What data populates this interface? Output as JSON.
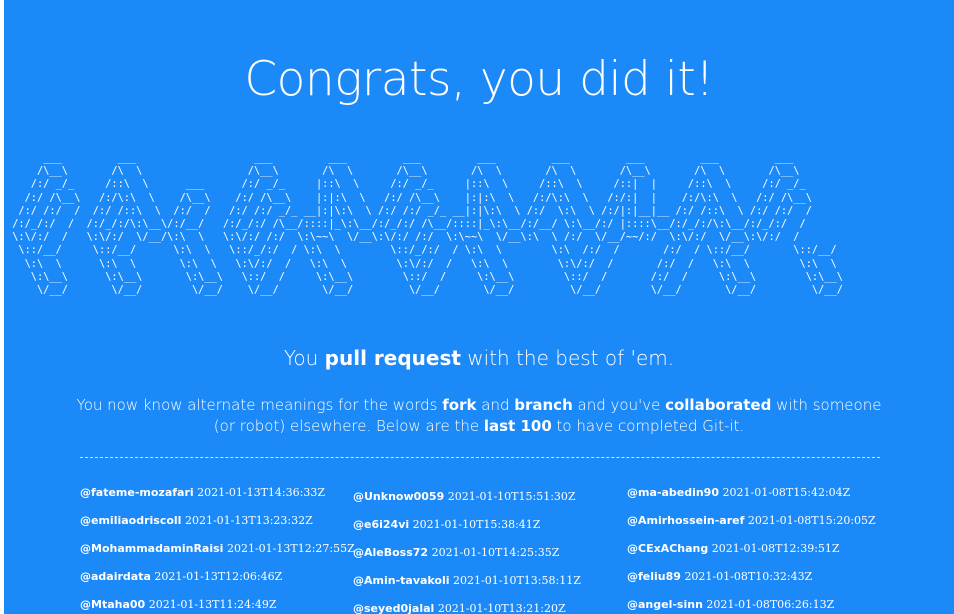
{
  "header": {
    "title": "Congrats, you did it!"
  },
  "ascii_art": "      ___         ___                   ___         ___         ___         ___         ___         ___         ___         ___     \n     /\\__\\       /\\  \\                 /\\__\\       /\\  \\       /\\__\\       /\\  \\       /\\  \\       /\\__\\       /\\  \\       /\\__\\    \n    /:/ _/_     /::\\  \\      ___      /:/ _/_     |::\\  \\     /:/ _/_     |::\\  \\     /::\\  \\     /::|  |     /::\\  \\     /:/ _/_   \n   /:/ /\\__\\   /:/\\:\\  \\    /\\__\\    /:/ /\\__\\    |:|:\\  \\   /:/ /\\__\\    |:|:\\  \\   /:/\\:\\  \\   /:/:|  |    /:/\\:\\  \\   /:/ /\\__\\  \n  /:/ /:/  /  /:/ /::\\  \\  /:/  /   /:/ /:/ _/_ __|:|\\:\\  \\ /:/ /:/ _/_ __|:|\\:\\  \\ /:/  \\:\\  \\ /:/|:|__|__ /:/ /::\\  \\ /:/ /:/  /  \n /:/_/:/  /  /:/_/:/\\:\\__\\/:/__/   /:/_/:/ /\\__/::::|_\\:\\__/:/_/:/ /\\__/::::|_\\:\\__/:/__/ \\:\\__/:/ |::::\\__/:/_/:/\\:\\__/:/_/:/  /   \n \\:\\/:/  /   \\:\\/:/  \\/__/\\:\\  \\   \\:\\/:/ /:/  \\:\\~~\\  \\/__\\:\\/:/ /:/  \\:\\~~\\  \\/__\\:\\  \\ /:/  \\/__/~~/:/  \\:\\/:/  \\/__\\:\\/:/  /    \n  \\::/__/     \\::/__/      \\:\\  \\   \\::/_/:/  / \\:\\  \\        \\::/_/:/  / \\:\\  \\        \\:\\  /:/  /       /:/  / \\::/__/       \\::/__/     \n   \\:\\  \\      \\:\\  \\       \\:\\  \\   \\:\\/:/  /   \\:\\  \\        \\:\\/:/  /   \\:\\  \\        \\:\\/:/  /       /:/  /   \\:\\  \\        \\:\\  \\     \n    \\:\\__\\      \\:\\__\\       \\:\\__\\   \\::/  /     \\:\\__\\        \\::/  /     \\:\\__\\        \\::/  /       /:/  /     \\:\\__\\        \\:\\__\\    \n     \\/__/       \\/__/        \\/__/    \\/__/       \\/__/         \\/__/       \\/__/         \\/__/        \\/__/       \\/__/         \\/__/    ",
  "tagline": {
    "pre": "You ",
    "bold": "pull request",
    "post": " with the best of 'em."
  },
  "description": {
    "p1": "You now know alternate meanings for the words ",
    "b1": "fork",
    "p2": " and ",
    "b2": "branch",
    "p3": " and you've ",
    "b3": "collaborated",
    "p4": " with someone (or robot) elsewhere. Below are the ",
    "b4": "last 100",
    "p5": " to have completed Git-it."
  },
  "completions": {
    "col1": [
      {
        "handle": "@fateme-mozafari",
        "time": "2021-01-13T14:36:33Z"
      },
      {
        "handle": "@emiliaodriscoll",
        "time": "2021-01-13T13:23:32Z"
      },
      {
        "handle": "@MohammadaminRaisi",
        "time": "2021-01-13T12:27:55Z"
      },
      {
        "handle": "@adairdata",
        "time": "2021-01-13T12:06:46Z"
      },
      {
        "handle": "@Mtaha00",
        "time": "2021-01-13T11:24:49Z"
      }
    ],
    "col2": [
      {
        "handle": "@Unknow0059",
        "time": "2021-01-10T15:51:30Z"
      },
      {
        "handle": "@e6i24vi",
        "time": "2021-01-10T15:38:41Z"
      },
      {
        "handle": "@AleBoss72",
        "time": "2021-01-10T14:25:35Z"
      },
      {
        "handle": "@Amin-tavakoli",
        "time": "2021-01-10T13:58:11Z"
      },
      {
        "handle": "@seyed0jalal",
        "time": "2021-01-10T13:21:20Z"
      }
    ],
    "col3": [
      {
        "handle": "@ma-abedin90",
        "time": "2021-01-08T15:42:04Z"
      },
      {
        "handle": "@Amirhossein-aref",
        "time": "2021-01-08T15:20:05Z"
      },
      {
        "handle": "@CExAChang",
        "time": "2021-01-08T12:39:51Z"
      },
      {
        "handle": "@feliu89",
        "time": "2021-01-08T10:32:43Z"
      },
      {
        "handle": "@angel-sinn",
        "time": "2021-01-08T06:26:13Z"
      }
    ]
  },
  "colors": {
    "background": "#1c89f8",
    "text": "#ffffff"
  }
}
